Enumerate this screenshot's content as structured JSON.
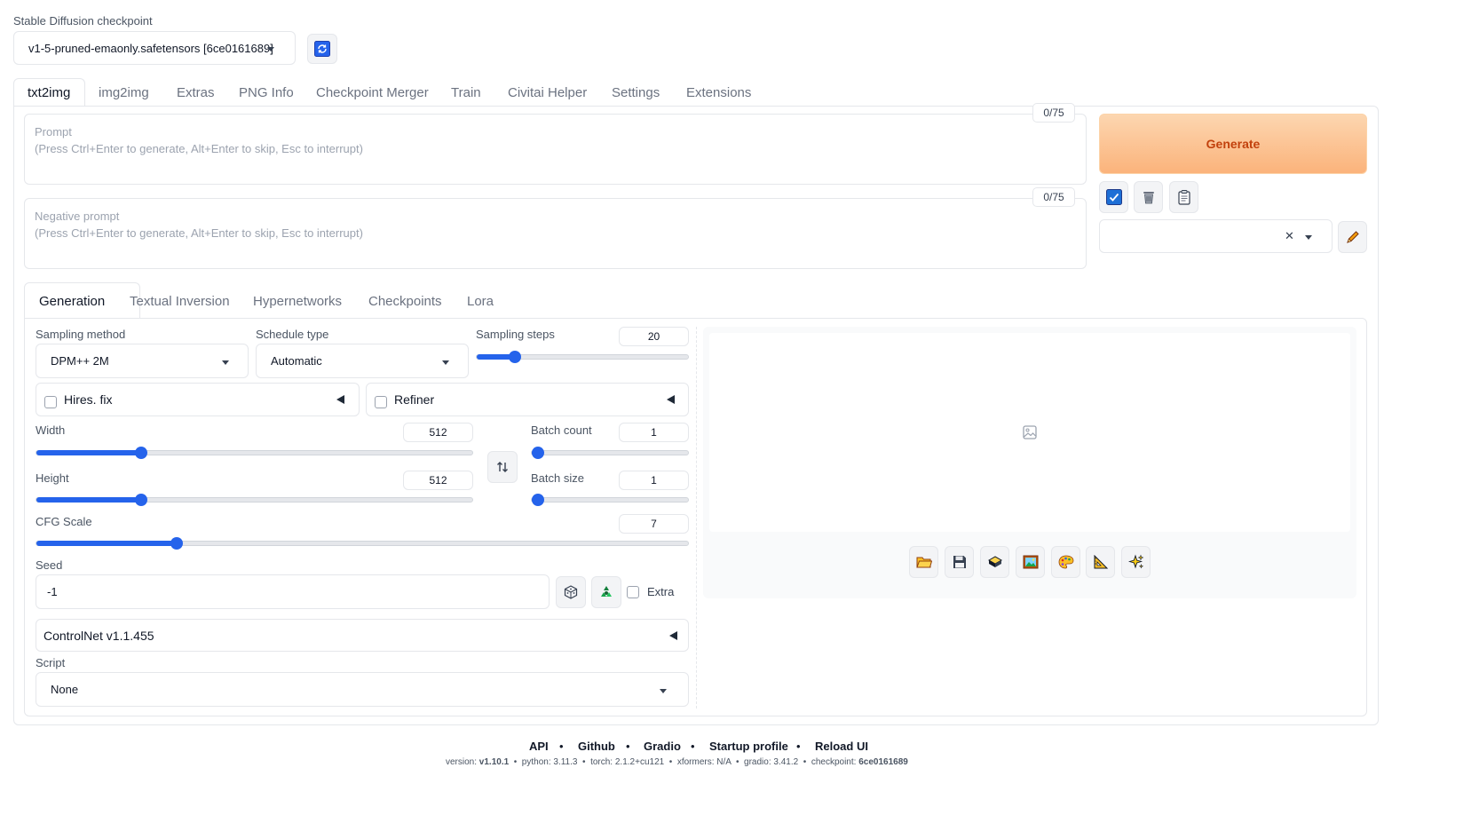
{
  "checkpoint": {
    "label": "Stable Diffusion checkpoint",
    "value": "v1-5-pruned-emaonly.safetensors [6ce0161689]"
  },
  "main_tabs": [
    "txt2img",
    "img2img",
    "Extras",
    "PNG Info",
    "Checkpoint Merger",
    "Train",
    "Civitai Helper",
    "Settings",
    "Extensions"
  ],
  "prompt": {
    "label": "Prompt",
    "hint": "(Press Ctrl+Enter to generate, Alt+Enter to skip, Esc to interrupt)",
    "counter": "0/75"
  },
  "negative_prompt": {
    "label": "Negative prompt",
    "hint": "(Press Ctrl+Enter to generate, Alt+Enter to skip, Esc to interrupt)",
    "counter": "0/75"
  },
  "generate_label": "Generate",
  "sub_tabs": [
    "Generation",
    "Textual Inversion",
    "Hypernetworks",
    "Checkpoints",
    "Lora"
  ],
  "sampling_method": {
    "label": "Sampling method",
    "value": "DPM++ 2M"
  },
  "schedule_type": {
    "label": "Schedule type",
    "value": "Automatic"
  },
  "sampling_steps": {
    "label": "Sampling steps",
    "value": "20",
    "fraction": 0.16
  },
  "hires_fix": {
    "label": "Hires. fix"
  },
  "refiner": {
    "label": "Refiner"
  },
  "width": {
    "label": "Width",
    "value": "512",
    "fraction": 0.233
  },
  "height": {
    "label": "Height",
    "value": "512",
    "fraction": 0.233
  },
  "batch_count": {
    "label": "Batch count",
    "value": "1",
    "fraction": 0.0
  },
  "batch_size": {
    "label": "Batch size",
    "value": "1",
    "fraction": 0.0
  },
  "cfg_scale": {
    "label": "CFG Scale",
    "value": "7",
    "fraction": 0.21
  },
  "seed": {
    "label": "Seed",
    "value": "-1",
    "extra_label": "Extra"
  },
  "controlnet": {
    "label": "ControlNet v1.1.455"
  },
  "script": {
    "label": "Script",
    "value": "None"
  },
  "footer": {
    "links": [
      "API",
      "Github",
      "Gradio",
      "Startup profile",
      "Reload UI"
    ],
    "version_prefix": "version:",
    "version": "v1.10.1",
    "python": "python: 3.11.3",
    "torch": "torch: 2.1.2+cu121",
    "xformers": "xformers: N/A",
    "gradio": "gradio: 3.41.2",
    "checkpoint_prefix": "checkpoint:",
    "checkpoint": "6ce0161689"
  },
  "colors": {
    "accent": "#2563eb",
    "generate_bg": "#fbc08e",
    "generate_text": "#c2410c"
  },
  "icons": [
    "refresh-icon",
    "checkbox-icon",
    "trash-icon",
    "clipboard-icon",
    "close-icon",
    "pencil-icon",
    "swap-icon",
    "dice-icon",
    "recycle-icon",
    "image-placeholder-icon",
    "folder-icon",
    "save-icon",
    "zip-icon",
    "image-icon",
    "palette-icon",
    "ruler-icon",
    "sparkle-icon"
  ]
}
